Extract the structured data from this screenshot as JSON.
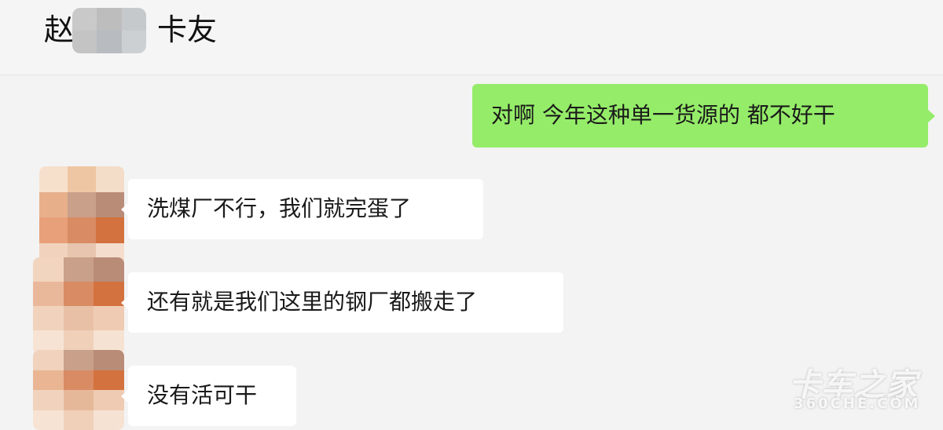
{
  "header": {
    "name_prefix": "赵",
    "name_suffix": "卡友"
  },
  "messages": [
    {
      "side": "sent",
      "text": "对啊 今年这种单一货源的 都不好干"
    },
    {
      "side": "received",
      "text": "洗煤厂不行，我们就完蛋了"
    },
    {
      "side": "received",
      "text": "还有就是我们这里的钢厂都搬走了"
    },
    {
      "side": "received",
      "text": "没有活可干"
    }
  ],
  "watermark": {
    "brand": "卡车之家",
    "domain": "360CHE.COM"
  },
  "colors": {
    "sent_bubble": "#95ec69",
    "received_bubble": "#ffffff",
    "background": "#f3f3f3"
  }
}
